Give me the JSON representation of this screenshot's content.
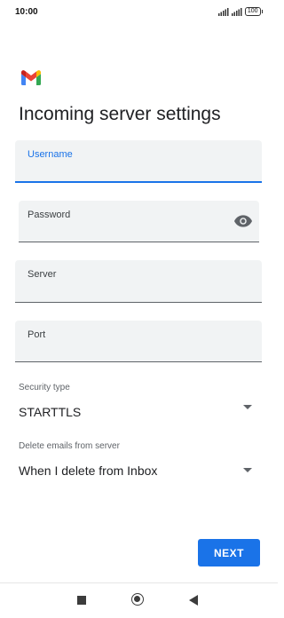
{
  "status_bar": {
    "time": "10:00",
    "battery": "100"
  },
  "logo": {
    "icon": "gmail-logo-icon",
    "colors": {
      "red": "#EA4335",
      "blue": "#4285F4",
      "green": "#34A853",
      "yellow": "#FBBC04",
      "dark_red": "#C5221F"
    }
  },
  "page": {
    "title": "Incoming server settings"
  },
  "form": {
    "username": {
      "label": "Username",
      "value": "",
      "focused": true
    },
    "password": {
      "label": "Password",
      "value": "",
      "icon": "eye-icon"
    },
    "server": {
      "label": "Server",
      "value": ""
    },
    "port": {
      "label": "Port",
      "value": ""
    },
    "security_type": {
      "label": "Security type",
      "selected": "STARTTLS"
    },
    "delete_emails": {
      "label": "Delete emails from server",
      "selected": "When I delete from Inbox"
    }
  },
  "actions": {
    "next_label": "NEXT"
  },
  "colors": {
    "accent": "#1A73E8",
    "field_bg": "#F1F3F4"
  },
  "nav": {
    "recents_icon": "square-icon",
    "home_icon": "circle-icon",
    "back_icon": "back-triangle-icon"
  }
}
